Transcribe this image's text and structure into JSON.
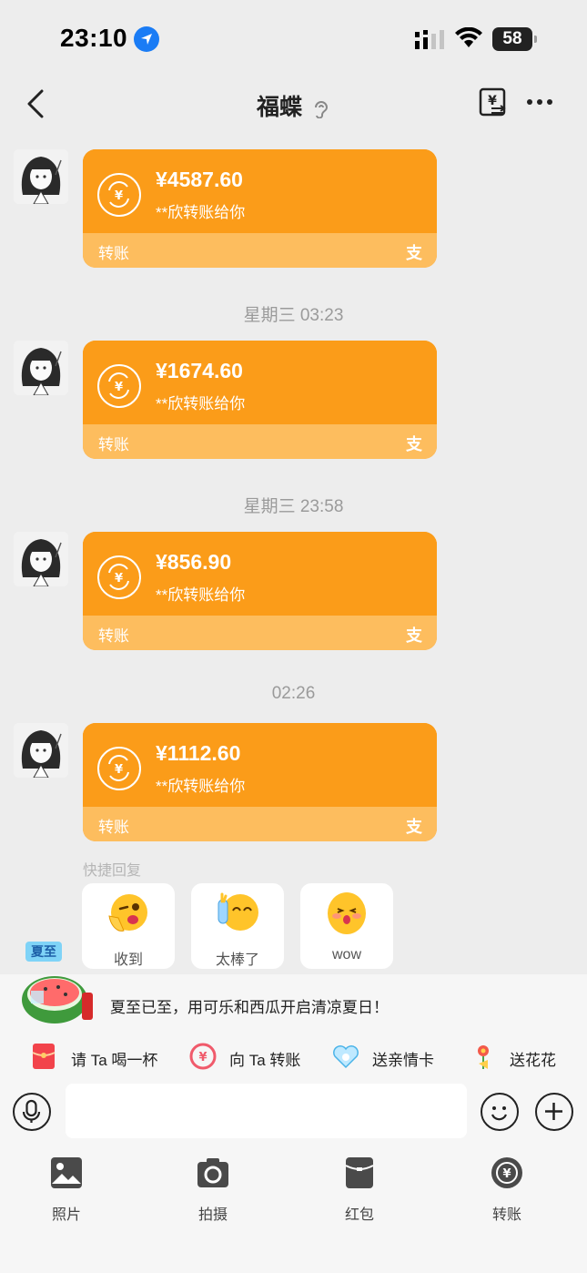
{
  "status_bar": {
    "time": "23:10",
    "battery": "58"
  },
  "nav": {
    "title": "福蝶"
  },
  "messages": [
    {
      "amount": "¥4587.60",
      "desc": "**欣转账给你",
      "label": "转账",
      "pay_icon": "支"
    },
    {
      "amount": "¥1674.60",
      "desc": "**欣转账给你",
      "label": "转账",
      "pay_icon": "支"
    },
    {
      "amount": "¥856.90",
      "desc": "**欣转账给你",
      "label": "转账",
      "pay_icon": "支"
    },
    {
      "amount": "¥1112.60",
      "desc": "**欣转账给你",
      "label": "转账",
      "pay_icon": "支"
    }
  ],
  "timestamps": [
    "星期三 03:23",
    "星期三 23:58",
    "02:26"
  ],
  "quick_reply": {
    "title": "快捷回复",
    "items": [
      {
        "label": "收到"
      },
      {
        "label": "太棒了"
      },
      {
        "label": "wow"
      }
    ]
  },
  "promo": {
    "text": "夏至已至，用可乐和西瓜开启清凉夏日！",
    "badge": "夏至"
  },
  "gifts": [
    {
      "label": "请 Ta 喝一杯"
    },
    {
      "label": "向 Ta 转账"
    },
    {
      "label": "送亲情卡"
    },
    {
      "label": "送花花"
    }
  ],
  "input": {
    "value": "",
    "placeholder": ""
  },
  "tools": [
    {
      "label": "照片",
      "icon": "photo-icon"
    },
    {
      "label": "拍摄",
      "icon": "camera-icon"
    },
    {
      "label": "红包",
      "icon": "red-packet-icon"
    },
    {
      "label": "转账",
      "icon": "transfer-icon"
    }
  ],
  "colors": {
    "bubble": "#fb9c19",
    "bubble_footer": "#fdbd5e",
    "background": "#ededed"
  }
}
